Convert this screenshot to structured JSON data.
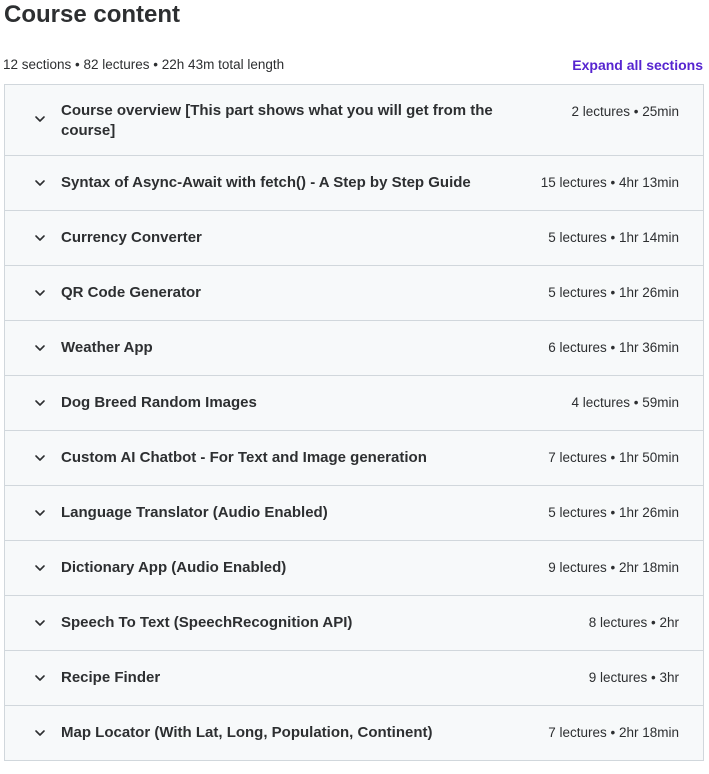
{
  "header": {
    "title": "Course content",
    "summary": "12 sections • 82 lectures • 22h 43m total length",
    "expand_all_label": "Expand all sections"
  },
  "icons": {
    "section_toggle": "chevron-down-icon"
  },
  "colors": {
    "accent": "#5624d0",
    "section_background": "#f7f9fa",
    "border": "#d1d7dc",
    "text": "#2d2f31"
  },
  "sections": [
    {
      "title": "Course overview [This part shows what you will get from the course]",
      "meta": "2 lectures • 25min"
    },
    {
      "title": "Syntax of Async-Await with fetch() - A Step by Step Guide",
      "meta": "15 lectures • 4hr 13min"
    },
    {
      "title": "Currency Converter",
      "meta": "5 lectures • 1hr 14min"
    },
    {
      "title": "QR Code Generator",
      "meta": "5 lectures • 1hr 26min"
    },
    {
      "title": "Weather App",
      "meta": "6 lectures • 1hr 36min"
    },
    {
      "title": "Dog Breed Random Images",
      "meta": "4 lectures • 59min"
    },
    {
      "title": "Custom AI Chatbot - For Text and Image generation",
      "meta": "7 lectures • 1hr 50min"
    },
    {
      "title": "Language Translator (Audio Enabled)",
      "meta": "5 lectures • 1hr 26min"
    },
    {
      "title": "Dictionary App (Audio Enabled)",
      "meta": "9 lectures • 2hr 18min"
    },
    {
      "title": "Speech To Text (SpeechRecognition API)",
      "meta": "8 lectures • 2hr"
    },
    {
      "title": "Recipe Finder",
      "meta": "9 lectures • 3hr"
    },
    {
      "title": "Map Locator (With Lat, Long, Population, Continent)",
      "meta": "7 lectures • 2hr 18min"
    }
  ]
}
